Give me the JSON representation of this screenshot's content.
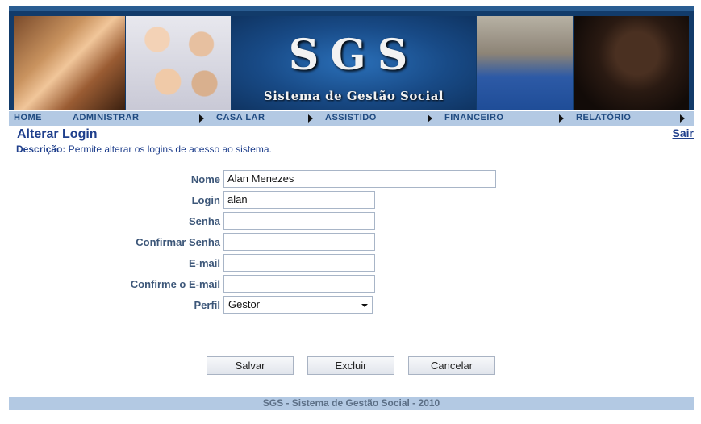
{
  "banner": {
    "title": "SGS",
    "subtitle": "Sistema de Gestão Social"
  },
  "menu": {
    "items": [
      {
        "label": "HOME"
      },
      {
        "label": "ADMINISTRAR"
      },
      {
        "label": "CASA LAR"
      },
      {
        "label": "ASSISTIDO"
      },
      {
        "label": "FINANCEIRO"
      },
      {
        "label": "RELATÓRIO"
      }
    ]
  },
  "page": {
    "title": "Alterar Login",
    "desc_label": "Descrição:",
    "desc_text": " Permite alterar os logins de acesso ao sistema.",
    "logout": "Sair"
  },
  "form": {
    "nome": {
      "label": "Nome",
      "value": "Alan Menezes"
    },
    "login": {
      "label": "Login",
      "value": "alan"
    },
    "senha": {
      "label": "Senha",
      "value": ""
    },
    "confirmar_senha": {
      "label": "Confirmar Senha",
      "value": ""
    },
    "email": {
      "label": "E-mail",
      "value": ""
    },
    "confirme_email": {
      "label": "Confirme o E-mail",
      "value": ""
    },
    "perfil": {
      "label": "Perfil",
      "value": "Gestor"
    }
  },
  "buttons": {
    "save": "Salvar",
    "delete": "Excluir",
    "cancel": "Cancelar"
  },
  "footer": {
    "text": "SGS - Sistema de Gestão Social - 2010"
  },
  "colors": {
    "menu_bg": "#b3c9e3",
    "banner_bg": "#123b6a",
    "title_text": "#1f3f8c"
  },
  "icons": {
    "menu_arrow": "triangle-right-icon",
    "select_caret": "chevron-down-icon"
  }
}
